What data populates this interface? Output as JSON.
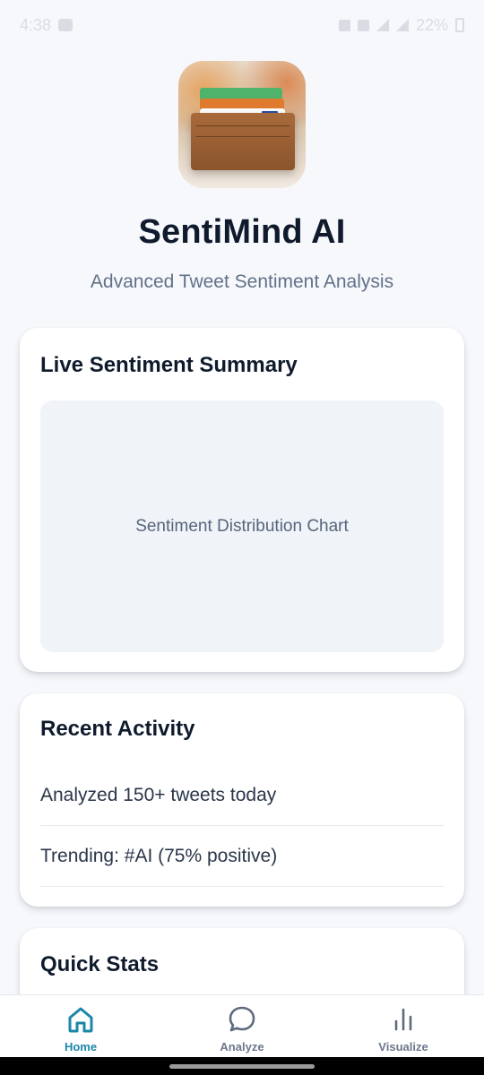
{
  "status_bar": {
    "time": "4:38",
    "battery": "22%"
  },
  "app": {
    "title": "SentiMind AI",
    "subtitle": "Advanced Tweet Sentiment Analysis"
  },
  "summary_card": {
    "title": "Live Sentiment Summary",
    "chart_placeholder": "Sentiment Distribution Chart"
  },
  "activity_card": {
    "title": "Recent Activity",
    "items": [
      "Analyzed 150+ tweets today",
      "Trending: #AI (75% positive)"
    ]
  },
  "stats_card": {
    "title": "Quick Stats"
  },
  "bottom_nav": {
    "items": [
      {
        "label": "Home",
        "icon": "home-icon",
        "active": true
      },
      {
        "label": "Analyze",
        "icon": "chat-bubble-icon",
        "active": false
      },
      {
        "label": "Visualize",
        "icon": "bar-chart-icon",
        "active": false
      }
    ]
  },
  "colors": {
    "accent": "#1b87a9",
    "background": "#f6f8fb",
    "title": "#0f1b2d"
  }
}
